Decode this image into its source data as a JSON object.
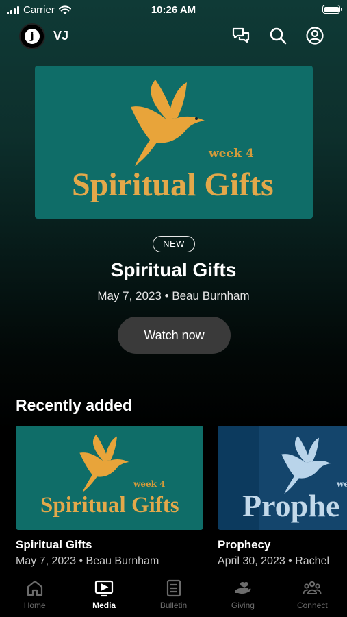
{
  "status_bar": {
    "carrier": "Carrier",
    "time": "10:26 AM"
  },
  "header": {
    "logo_glyph": "j",
    "brand": "VJ",
    "icons": [
      "chat-icon",
      "search-icon",
      "account-icon"
    ]
  },
  "hero": {
    "artwork": {
      "week": "week 4",
      "title": "Spiritual Gifts"
    },
    "badge": "NEW",
    "title": "Spiritual Gifts",
    "meta": "May 7, 2023 • Beau Burnham",
    "button": "Watch now"
  },
  "recent": {
    "title": "Recently added",
    "items": [
      {
        "art_week": "week 4",
        "art_title": "Spiritual Gifts",
        "title": "Spiritual Gifts",
        "meta": "May 7, 2023 • Beau Burnham",
        "art_color": "#0f6d68"
      },
      {
        "art_week": "we",
        "art_title": "Prophe",
        "title": "Prophecy",
        "meta": "April 30, 2023 • Rachel",
        "art_color": "#0c3a5e"
      }
    ]
  },
  "tabs": [
    {
      "label": "Home",
      "icon": "home-icon"
    },
    {
      "label": "Media",
      "icon": "tv-icon"
    },
    {
      "label": "Bulletin",
      "icon": "bulletin-icon"
    },
    {
      "label": "Giving",
      "icon": "giving-hand-icon"
    },
    {
      "label": "Connect",
      "icon": "people-icon"
    }
  ],
  "active_tab": "Media",
  "colors": {
    "accent_gold": "#e3a84a",
    "art_teal": "#0f6d68",
    "art_blue": "#0c3a5e",
    "button_bg": "#3a3a3a"
  }
}
